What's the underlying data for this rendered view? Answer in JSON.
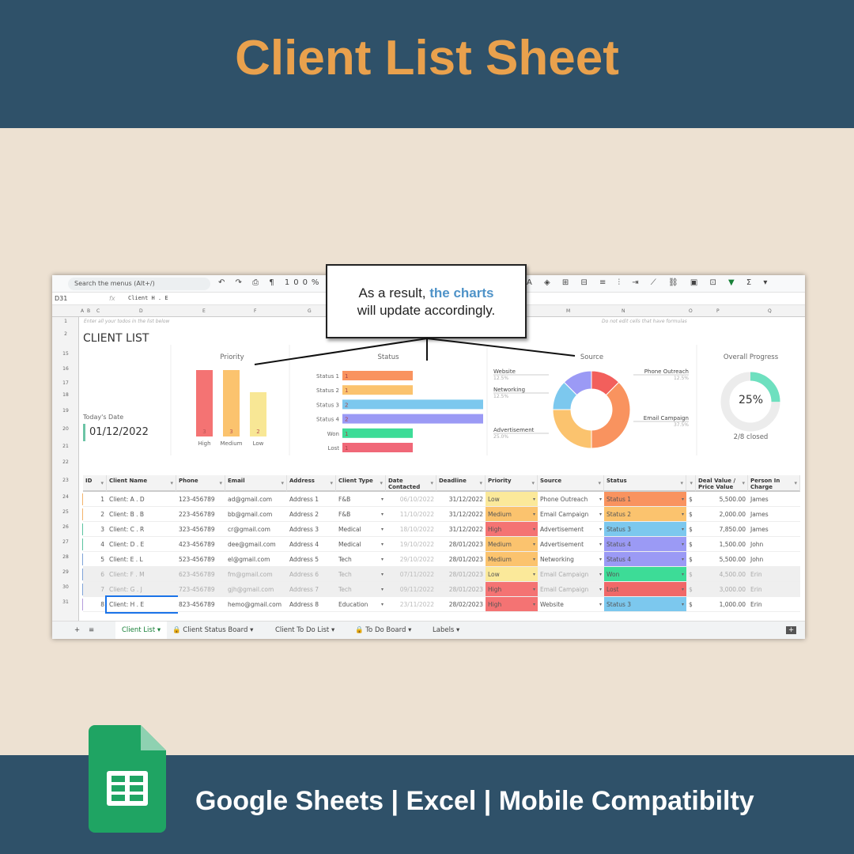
{
  "banner": {
    "title": "Client List Sheet",
    "tagline": "Google Sheets | Excel | Mobile Compatibilty"
  },
  "callout": {
    "line1_prefix": "As a result, ",
    "line1_highlight": "the charts",
    "line2": "will update accordingly."
  },
  "toolbar": {
    "search_placeholder": "Search the menus (Alt+/)",
    "zoom": "100%",
    "currency": "£"
  },
  "formula_bar": {
    "cell_ref": "D31",
    "fx": "fx",
    "value": "Client H . E"
  },
  "columns": [
    "A",
    "B",
    "C",
    "D",
    "E",
    "F",
    "G",
    "M",
    "N",
    "O",
    "P",
    "Q"
  ],
  "row_numbers": [
    "1",
    "2",
    "15",
    "16",
    "17",
    "18",
    "19",
    "20",
    "21",
    "22",
    "23",
    "24",
    "25",
    "26",
    "27",
    "28",
    "29",
    "30",
    "31"
  ],
  "notes": {
    "left": "Enter all your todos in the list below",
    "right": "Do not edit cells that have formulas"
  },
  "sheet_title": "CLIENT LIST",
  "today": {
    "label": "Today's Date",
    "value": "01/12/2022"
  },
  "colors": {
    "accent": "#e9a14d",
    "banner": "#2f5169",
    "sheets_green": "#1fa463",
    "progress": "#6ee0bf"
  },
  "chart_data": [
    {
      "type": "bar",
      "title": "Priority",
      "categories": [
        "High",
        "Medium",
        "Low"
      ],
      "values": [
        3,
        3,
        2
      ],
      "colors": [
        "#f47373",
        "#fbc36e",
        "#f8e795"
      ]
    },
    {
      "type": "bar",
      "orientation": "horizontal",
      "title": "Status",
      "categories": [
        "Status 1",
        "Status 2",
        "Status 3",
        "Status 4",
        "Won",
        "Lost"
      ],
      "values": [
        1,
        1,
        2,
        2,
        1,
        1
      ],
      "colors": [
        "#f9935f",
        "#fbc36e",
        "#7cc8ee",
        "#9b9af5",
        "#3ddc97",
        "#f06878"
      ]
    },
    {
      "type": "pie",
      "donut": true,
      "title": "Source",
      "categories": [
        "Phone Outreach",
        "Email Campaign",
        "Advertisement",
        "Networking",
        "Website"
      ],
      "values": [
        12.5,
        37.5,
        25.0,
        12.5,
        12.5
      ],
      "labels": [
        "12.5%",
        "37.5%",
        "25.0%",
        "12.5%",
        "12.5%"
      ],
      "colors": [
        "#f25f5c",
        "#f9935f",
        "#fbc36e",
        "#7cc8ee",
        "#9b9af5"
      ]
    },
    {
      "type": "pie",
      "donut": true,
      "title": "Overall Progress",
      "value_percent": 25,
      "label": "25%",
      "caption": "2/8 closed"
    }
  ],
  "table": {
    "headers": [
      "ID",
      "Client Name",
      "Phone",
      "Email",
      "Address",
      "Client Type",
      "Date Contacted",
      "Deadline",
      "Priority",
      "Source",
      "Status",
      "",
      "Deal Value / Price Value",
      "Person In Charge"
    ],
    "rows": [
      [
        "1",
        "Client: A . D",
        "123-456789",
        "ad@gmail.com",
        "Address 1",
        "F&B",
        "06/10/2022",
        "31/12/2022",
        "Low",
        "Phone Outreach",
        "Status 1",
        "$",
        "5,500.00",
        "James"
      ],
      [
        "2",
        "Client: B . B",
        "223-456789",
        "bb@gmail.com",
        "Address 2",
        "F&B",
        "11/10/2022",
        "31/12/2022",
        "Medium",
        "Email Campaign",
        "Status 2",
        "$",
        "2,000.00",
        "James"
      ],
      [
        "3",
        "Client: C . R",
        "323-456789",
        "cr@gmail.com",
        "Address 3",
        "Medical",
        "18/10/2022",
        "31/12/2022",
        "High",
        "Advertisement",
        "Status 3",
        "$",
        "7,850.00",
        "James"
      ],
      [
        "4",
        "Client: D . E",
        "423-456789",
        "dee@gmail.com",
        "Address 4",
        "Medical",
        "19/10/2022",
        "28/01/2023",
        "Medium",
        "Advertisement",
        "Status 4",
        "$",
        "1,500.00",
        "John"
      ],
      [
        "5",
        "Client: E . L",
        "523-456789",
        "el@gmail.com",
        "Address 5",
        "Tech",
        "29/10/2022",
        "28/01/2023",
        "Medium",
        "Networking",
        "Status 4",
        "$",
        "5,500.00",
        "John"
      ],
      [
        "6",
        "Client: F . M",
        "623-456789",
        "fm@gmail.com",
        "Address 6",
        "Tech",
        "07/11/2022",
        "28/01/2023",
        "Low",
        "Email Campaign",
        "Won",
        "$",
        "4,500.00",
        "Erin"
      ],
      [
        "7",
        "Client: G . J",
        "723-456789",
        "gjh@gmail.com",
        "Address 7",
        "Tech",
        "09/11/2022",
        "28/01/2023",
        "High",
        "Email Campaign",
        "Lost",
        "$",
        "3,000.00",
        "Erin"
      ],
      [
        "8",
        "Client: H . E",
        "823-456789",
        "hemo@gmail.com",
        "Address 8",
        "Education",
        "23/11/2022",
        "28/02/2023",
        "High",
        "Website",
        "Status 3",
        "$",
        "1,000.00",
        "Erin"
      ]
    ]
  },
  "tabs": [
    "Client List",
    "Client Status Board",
    "Client To Do List",
    "To Do Board",
    "Labels"
  ]
}
